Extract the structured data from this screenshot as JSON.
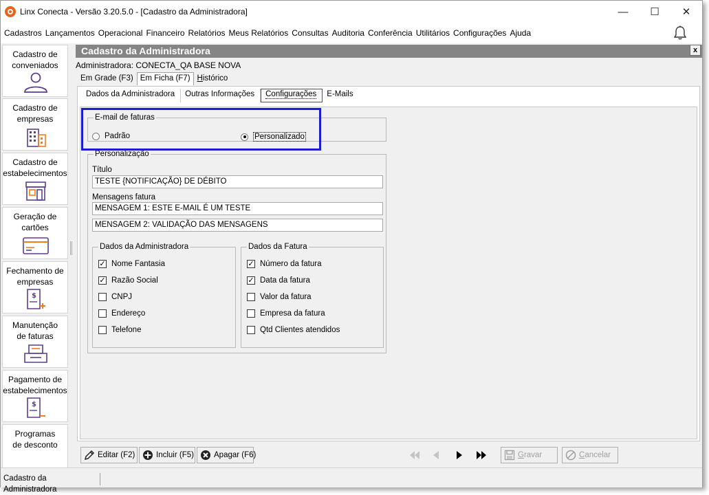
{
  "window": {
    "title": "Linx Conecta - Versão 3.20.5.0 - [Cadastro da Administradora]",
    "controls": {
      "minimize": "—",
      "maximize": "☐",
      "close": "✕"
    }
  },
  "menu": [
    "Cadastros",
    "Lançamentos",
    "Operacional",
    "Financeiro",
    "Relatórios",
    "Meus Relatórios",
    "Consultas",
    "Auditoria",
    "Conferência",
    "Utilitários",
    "Configurações",
    "Ajuda"
  ],
  "sidebar": {
    "items": [
      {
        "label1": "Cadastro de",
        "label2": "conveniados",
        "icon": "user-icon"
      },
      {
        "label1": "Cadastro de",
        "label2": "empresas",
        "icon": "building-icon"
      },
      {
        "label1": "Cadastro de",
        "label2": "estabelecimentos",
        "icon": "store-icon"
      },
      {
        "label1": "Geração de",
        "label2": "cartões",
        "icon": "card-icon"
      },
      {
        "label1": "Fechamento de",
        "label2": "empresas",
        "icon": "invoice-add-icon"
      },
      {
        "label1": "Manutenção",
        "label2": "de faturas",
        "icon": "tray-icon"
      },
      {
        "label1": "Pagamento de",
        "label2": "estabelecimentos",
        "icon": "invoice-pay-icon"
      },
      {
        "label1": "Programas",
        "label2": "de desconto",
        "icon": "discount-icon"
      }
    ]
  },
  "form": {
    "title": "Cadastro da Administradora",
    "close_label": "x",
    "admin_line": "Administradora: CONECTA_QA BASE NOVA",
    "view_tabs": [
      {
        "label": "Em Grade (F3)"
      },
      {
        "label": "Em Ficha (F7)"
      },
      {
        "label_u": "H",
        "label_rest": "istórico"
      }
    ],
    "sub_tabs": [
      "Dados da Administradora",
      "Outras Informações",
      "Configurações",
      "E-Mails"
    ],
    "email_group": {
      "legend": "E-mail de faturas",
      "option_default": "Padrão",
      "option_custom": "Personalizado",
      "selected": "Personalizado"
    },
    "personalization": {
      "legend": "Personalização",
      "title_label": "Título",
      "title_value": "TESTE {NOTIFICAÇÃO} DE DÉBITO",
      "messages_label": "Mensagens fatura",
      "message1": "MENSAGEM 1: ESTE E-MAIL É UM TESTE",
      "message2": "MENSAGEM 2: VALIDAÇÃO DAS MENSAGENS",
      "admin_data": {
        "legend": "Dados da Administradora",
        "items": [
          {
            "label": "Nome Fantasia",
            "checked": true
          },
          {
            "label": "Razão Social",
            "checked": true
          },
          {
            "label": "CNPJ",
            "checked": false
          },
          {
            "label": "Endereço",
            "checked": false
          },
          {
            "label": "Telefone",
            "checked": false
          }
        ]
      },
      "invoice_data": {
        "legend": "Dados da Fatura",
        "items": [
          {
            "label": "Número da fatura",
            "checked": true
          },
          {
            "label": "Data da fatura",
            "checked": true
          },
          {
            "label": "Valor da fatura",
            "checked": false
          },
          {
            "label": "Empresa da fatura",
            "checked": false
          },
          {
            "label": "Qtd Clientes atendidos",
            "checked": false
          }
        ]
      }
    },
    "buttons": {
      "edit": "Editar (F2)",
      "add": "Incluir (F5)",
      "delete": "Apagar (F6)",
      "save_u": "G",
      "save_rest": "ravar",
      "cancel_u": "C",
      "cancel_rest": "ancelar"
    },
    "check_mark": "✓"
  },
  "status": {
    "text": "Cadastro da Administradora"
  },
  "colors": {
    "accent_highlight": "#1c1cd0",
    "header_bg": "#858585",
    "app_icon": "#e8641a",
    "sidebar_icon": "#5a3f8e",
    "sidebar_icon_accent": "#f07c1e"
  }
}
